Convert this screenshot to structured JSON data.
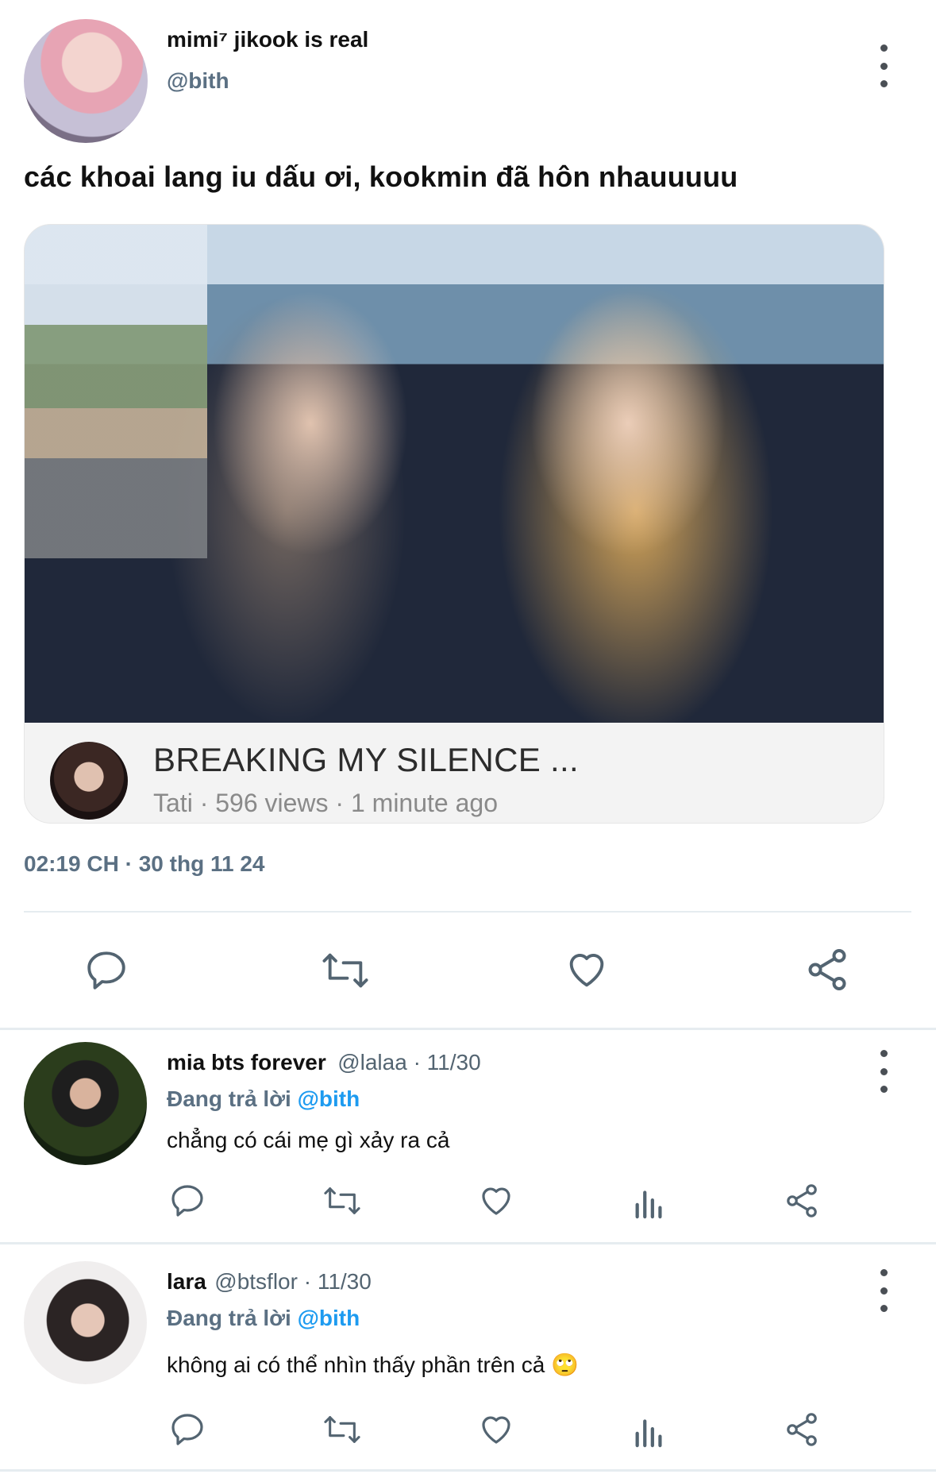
{
  "tweet": {
    "author_name": "mimi⁷ jikook is real",
    "author_handle": "@bith",
    "text": "các khoai lang iu dấu ơi, kookmin đã hôn nhauuuuu",
    "timestamp": "02:19 CH · 30 thg 11 24",
    "media": {
      "video_title": "BREAKING MY SILENCE ...",
      "video_meta": "Tati · 596 views · 1 minute ago"
    },
    "actions": [
      "reply-icon",
      "retweet-icon",
      "like-icon",
      "share-icon"
    ]
  },
  "replies": [
    {
      "name": "mia bts forever",
      "handle_date": "@lalaa · 11/30",
      "replying_prefix": "Đang trả lời",
      "replying_mention": "@bith",
      "text": "chẳng có cái mẹ gì xảy ra cả",
      "actions": [
        "reply-icon",
        "retweet-icon",
        "like-icon",
        "analytics-icon",
        "share-icon"
      ]
    },
    {
      "name": "lara",
      "handle_date": "@btsflor · 11/30",
      "replying_prefix": "Đang trả lời",
      "replying_mention": "@bith",
      "text": "không ai có thể nhìn thấy phần trên cả 🙄",
      "actions": [
        "reply-icon",
        "retweet-icon",
        "like-icon",
        "analytics-icon",
        "share-icon"
      ]
    }
  ],
  "colors": {
    "accent": "#1d9bf0",
    "muted": "#5b7083",
    "icon": "#536471",
    "divider": "#e6ecf0"
  }
}
